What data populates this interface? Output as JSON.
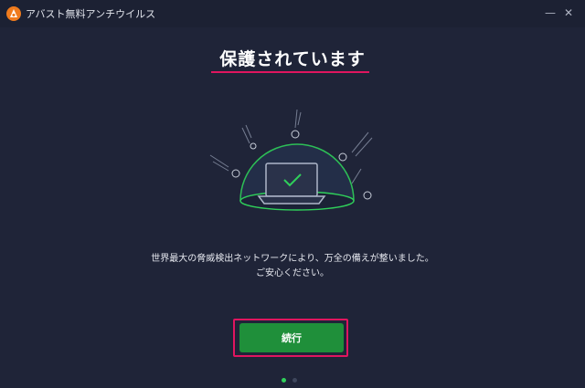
{
  "window": {
    "title": "アバスト無料アンチウイルス",
    "minimize_glyph": "—",
    "close_glyph": "✕"
  },
  "main": {
    "heading": "保護されています",
    "message_line1": "世界最大の脅威検出ネットワークにより、万全の備えが整いました。",
    "message_line2": "ご安心ください。",
    "continue_label": "続行"
  },
  "pagination": {
    "pages": 2,
    "current": 1
  },
  "colors": {
    "background": "#1f2438",
    "accent_green": "#1f8f3a",
    "highlight_pink": "#e0155f",
    "brand_orange": "#f07b1d"
  },
  "icons": [
    "avast-logo-icon",
    "minimize-icon",
    "close-icon",
    "shield-laptop-illustration",
    "checkmark-icon"
  ]
}
